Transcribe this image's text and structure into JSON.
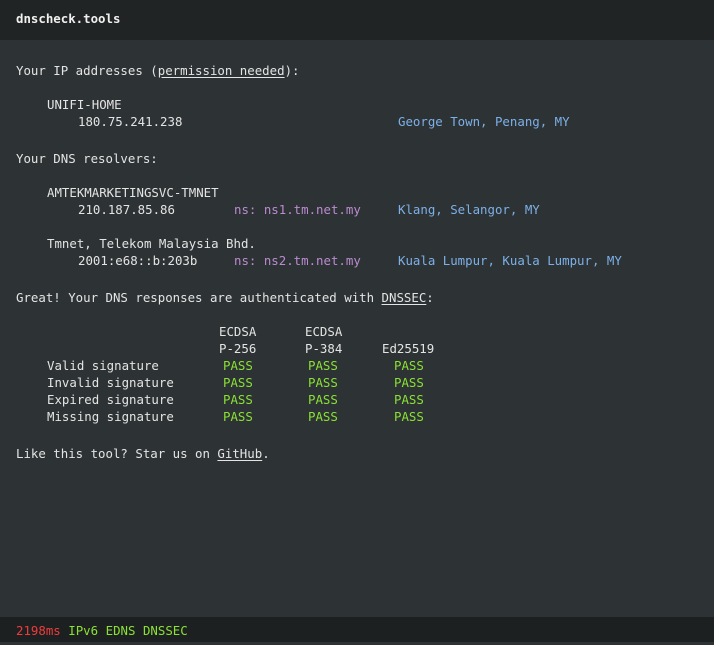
{
  "header": {
    "title": "dnscheck.tools"
  },
  "ip_section": {
    "prefix": "Your IP addresses (",
    "link": "permission needed",
    "suffix": "):",
    "entries": [
      {
        "org": "UNIFI-HOME",
        "ip": "180.75.241.238",
        "location": "George Town, Penang, MY"
      }
    ]
  },
  "dns_section": {
    "title": "Your DNS resolvers:",
    "entries": [
      {
        "org": "AMTEKMARKETINGSVC-TMNET",
        "ip": "210.187.85.86",
        "ns": "ns: ns1.tm.net.my",
        "location": "Klang, Selangor, MY"
      },
      {
        "org": "Tmnet, Telekom Malaysia Bhd.",
        "ip": "2001:e68::b:203b",
        "ns": "ns: ns2.tm.net.my",
        "location": "Kuala Lumpur, Kuala Lumpur, MY"
      }
    ]
  },
  "dnssec": {
    "prefix": "Great! Your DNS responses are authenticated with ",
    "link": "DNSSEC",
    "suffix": ":",
    "columns": [
      {
        "line1": "ECDSA",
        "line2": "P-256"
      },
      {
        "line1": "ECDSA",
        "line2": "P-384"
      },
      {
        "line1": "",
        "line2": "Ed25519"
      }
    ],
    "rows": [
      {
        "label": "Valid signature",
        "results": [
          "PASS",
          "PASS",
          "PASS"
        ]
      },
      {
        "label": "Invalid signature",
        "results": [
          "PASS",
          "PASS",
          "PASS"
        ]
      },
      {
        "label": "Expired signature",
        "results": [
          "PASS",
          "PASS",
          "PASS"
        ]
      },
      {
        "label": "Missing signature",
        "results": [
          "PASS",
          "PASS",
          "PASS"
        ]
      }
    ]
  },
  "promo": {
    "prefix": "Like this tool? Star us on ",
    "link": "GitHub",
    "suffix": "."
  },
  "footer": {
    "latency": "2198ms",
    "flags": [
      "IPv6",
      "EDNS",
      "DNSSEC"
    ]
  },
  "colors": {
    "background": "#2d3234",
    "header_bg": "#212425",
    "footer_bg": "#1d2021",
    "ns": "#bb8bd1",
    "location": "#7db0e8",
    "pass": "#8ae234",
    "latency": "#ef3b3b"
  }
}
